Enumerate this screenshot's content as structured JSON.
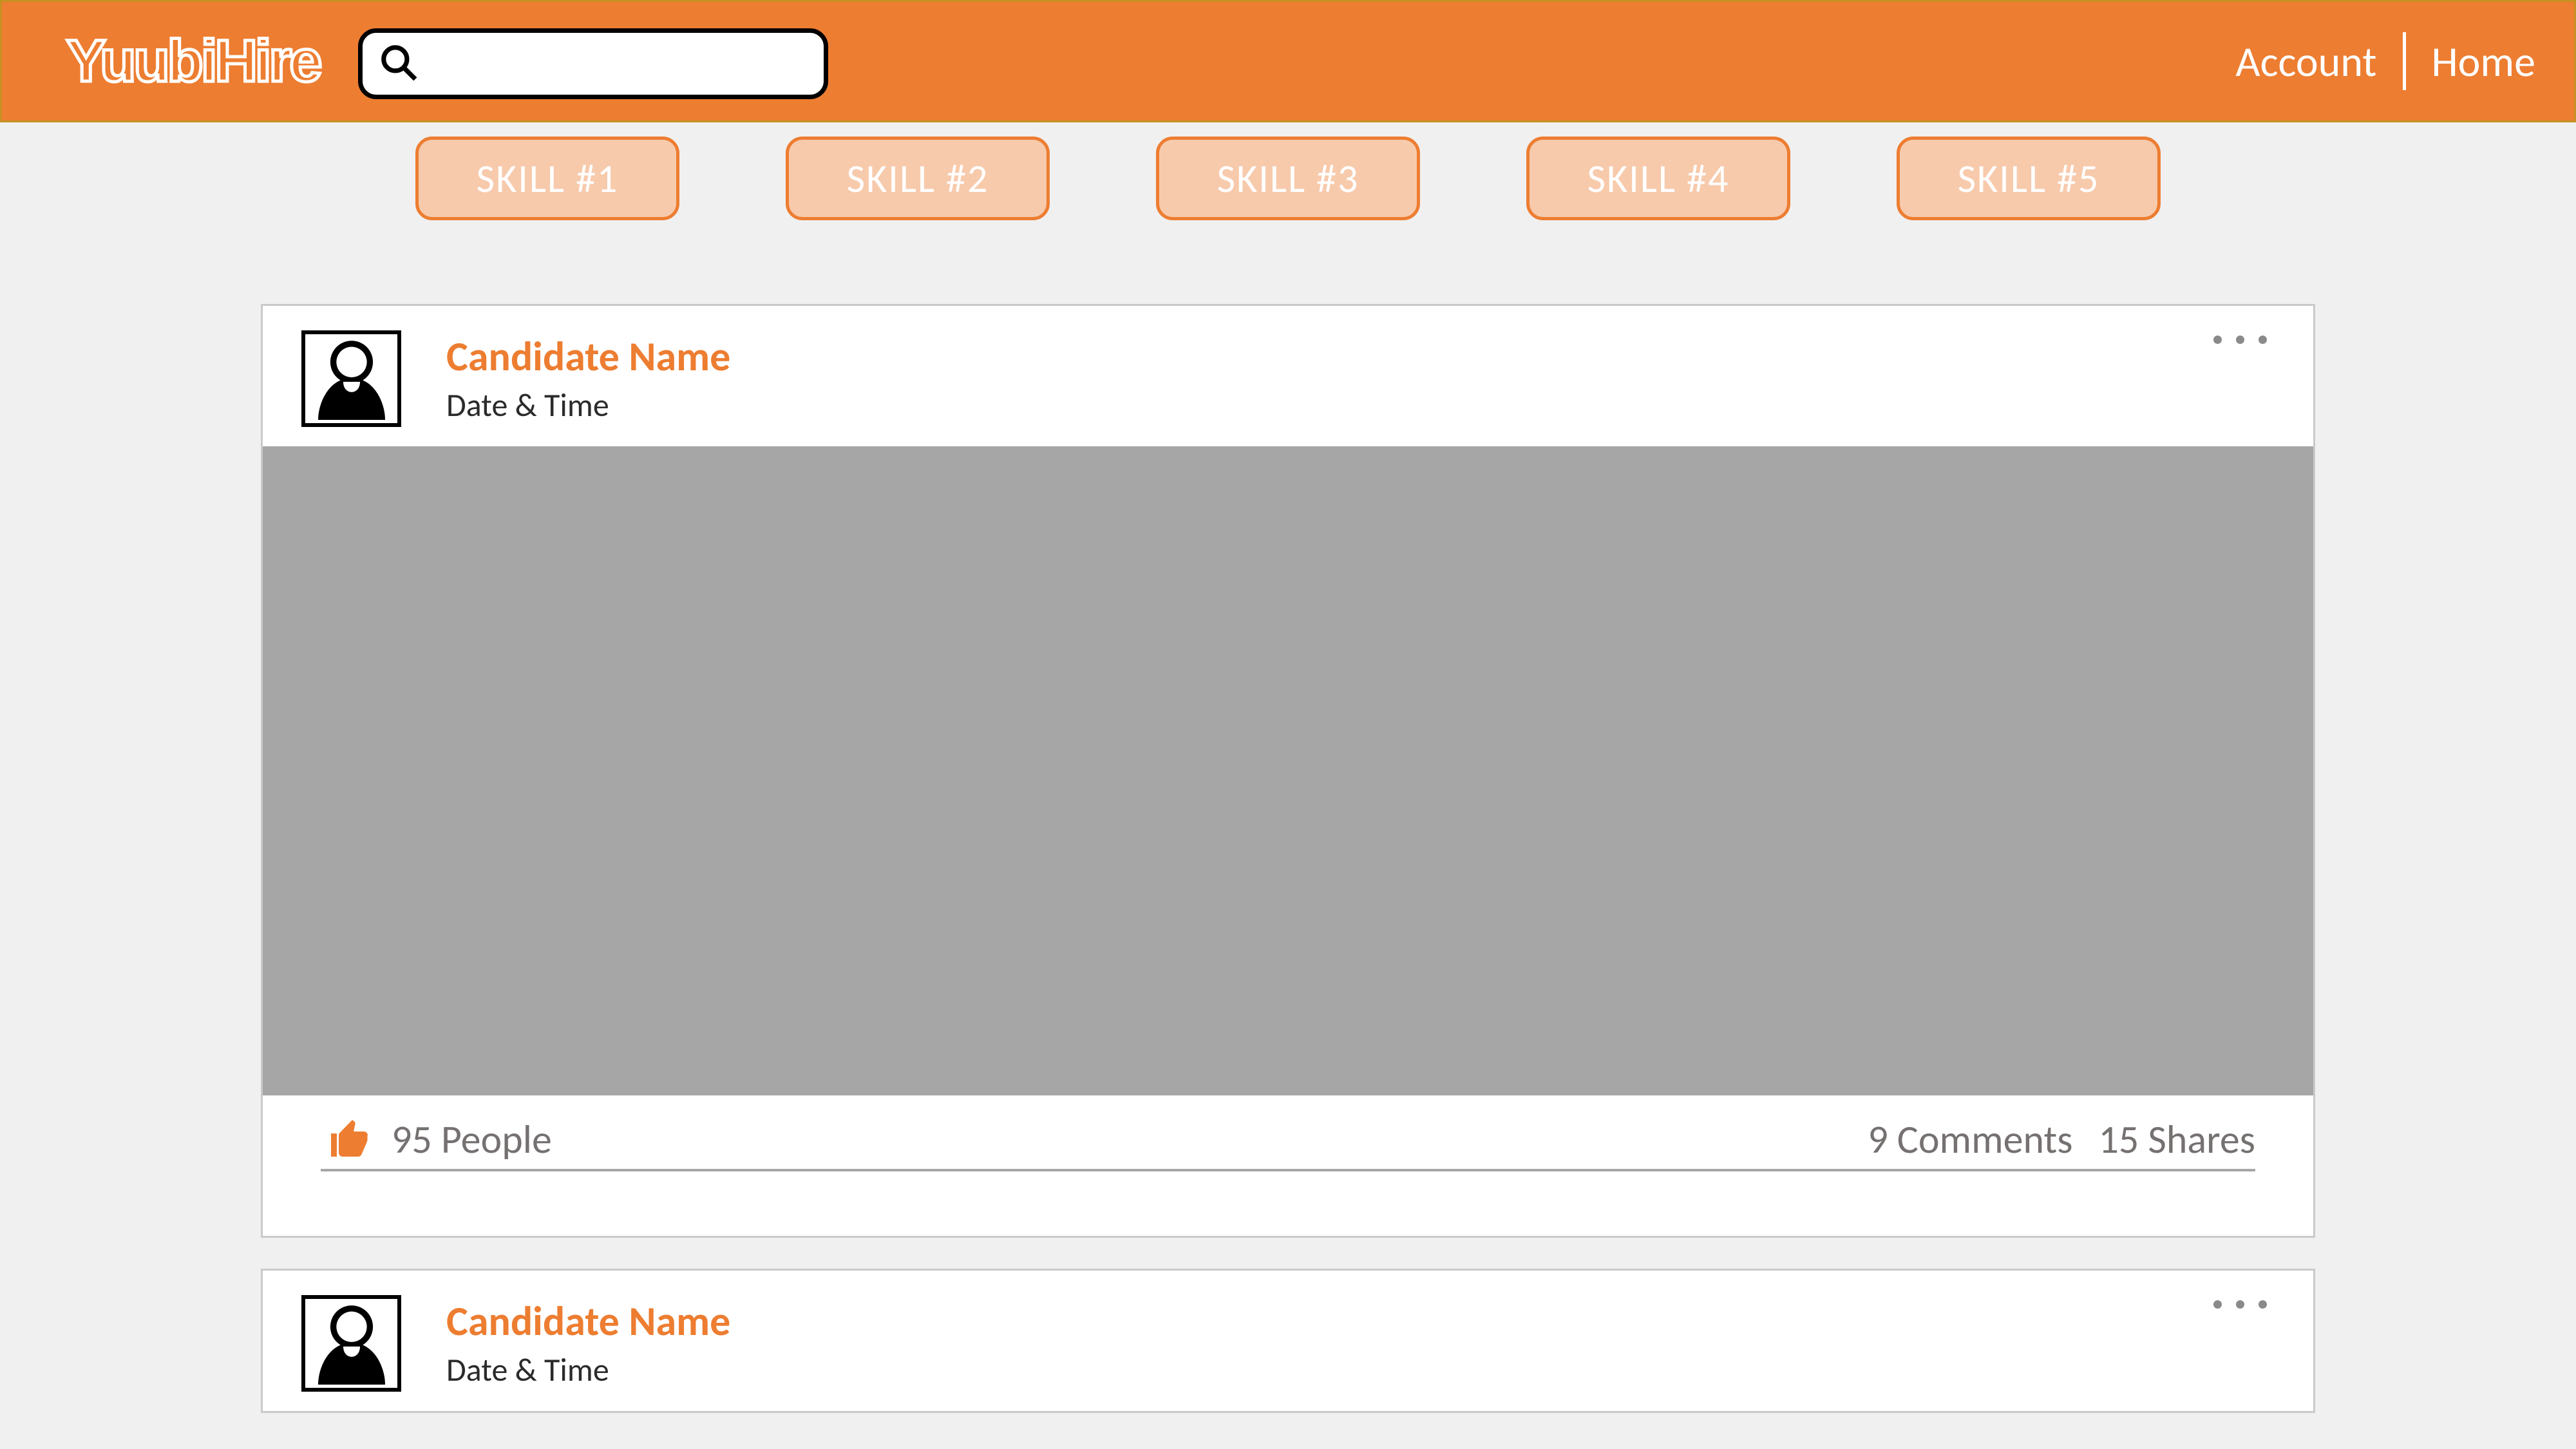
{
  "header": {
    "logo": "YuubiHire",
    "account_label": "Account",
    "home_label": "Home",
    "search_placeholder": ""
  },
  "skills": [
    {
      "label": "SKILL #1"
    },
    {
      "label": "SKILL #2"
    },
    {
      "label": "SKILL #3"
    },
    {
      "label": "SKILL #4"
    },
    {
      "label": "SKILL #5"
    }
  ],
  "feed": [
    {
      "name": "Candidate Name",
      "datetime": "Date & Time",
      "likes_text": "95 People",
      "comments_text": "9 Comments",
      "shares_text": "15 Shares"
    },
    {
      "name": "Candidate Name",
      "datetime": "Date & Time",
      "likes_text": "",
      "comments_text": "",
      "shares_text": ""
    }
  ],
  "colors": {
    "primary": "#ed7d31",
    "skill_bg": "#f7caac",
    "media_placeholder": "#a6a6a6",
    "muted_text": "#767171"
  }
}
